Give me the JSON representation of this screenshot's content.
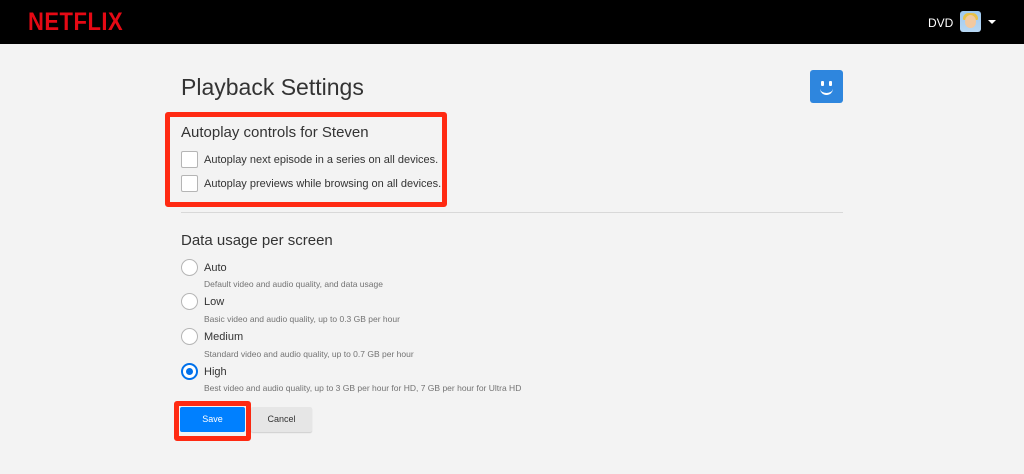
{
  "header": {
    "logo_text": "NETFLIX",
    "profile_name": "DVD",
    "logo_color": "#e50914"
  },
  "page": {
    "title": "Playback Settings"
  },
  "autoplay": {
    "heading": "Autoplay controls for Steven",
    "options": [
      {
        "label": "Autoplay next episode in a series on all devices.",
        "checked": false
      },
      {
        "label": "Autoplay previews while browsing on all devices.",
        "checked": false
      }
    ]
  },
  "data_usage": {
    "heading": "Data usage per screen",
    "options": [
      {
        "title": "Auto",
        "desc": "Default video and audio quality, and data usage",
        "selected": false
      },
      {
        "title": "Low",
        "desc": "Basic video and audio quality, up to 0.3 GB per hour",
        "selected": false
      },
      {
        "title": "Medium",
        "desc": "Standard video and audio quality, up to 0.7 GB per hour",
        "selected": false
      },
      {
        "title": "High",
        "desc": "Best video and audio quality, up to 3 GB per hour for HD, 7 GB per hour for Ultra HD",
        "selected": true
      }
    ]
  },
  "actions": {
    "save_label": "Save",
    "cancel_label": "Cancel",
    "save_color": "#0080ff"
  },
  "annotations": {
    "highlight_color": "#ff2a12"
  }
}
